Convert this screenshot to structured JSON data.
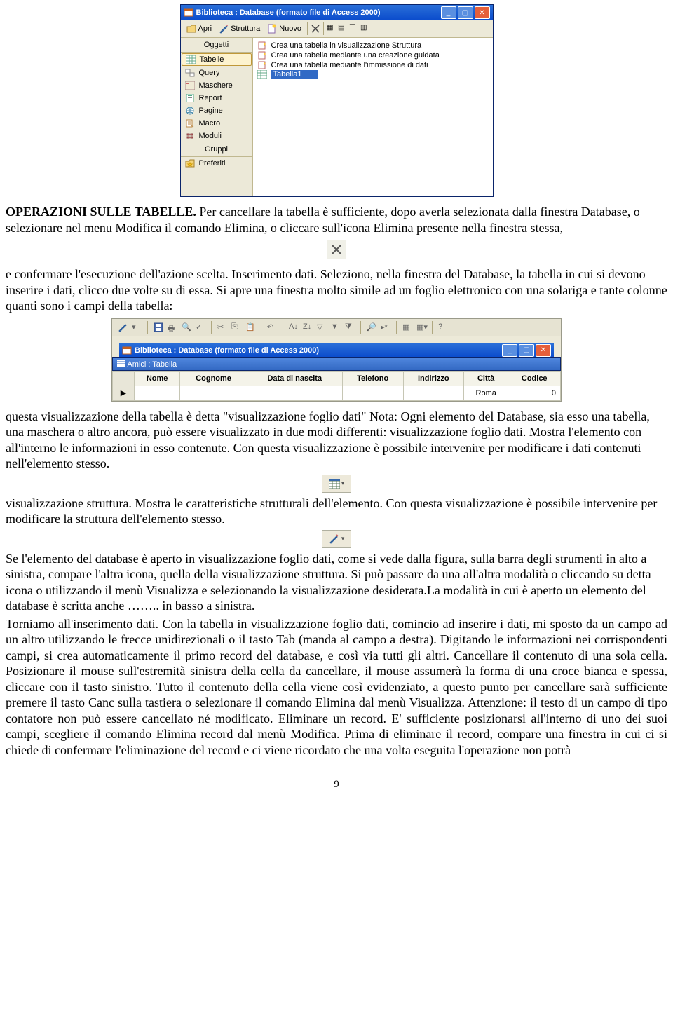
{
  "window1": {
    "title": "Biblioteca : Database (formato file di Access 2000)",
    "toolbar": {
      "apri": "Apri",
      "struttura": "Struttura",
      "nuovo": "Nuovo"
    },
    "sidebar": {
      "header_objects": "Oggetti",
      "items": [
        {
          "label": "Tabelle"
        },
        {
          "label": "Query"
        },
        {
          "label": "Maschere"
        },
        {
          "label": "Report"
        },
        {
          "label": "Pagine"
        },
        {
          "label": "Macro"
        },
        {
          "label": "Moduli"
        }
      ],
      "header_groups": "Gruppi",
      "group_item": "Preferiti"
    },
    "main": {
      "r1": "Crea una tabella in visualizzazione Struttura",
      "r2": "Crea una tabella mediante una creazione guidata",
      "r3": "Crea una tabella mediante l'immissione di dati",
      "r4": "Tabella1"
    }
  },
  "heading1": "OPERAZIONI SULLE TABELLE.",
  "para1": "Per cancellare la tabella è sufficiente, dopo averla selezionata dalla finestra Database, o selezionare nel menu Modifica il comando Elimina, o cliccare sull'icona Elimina presente nella finestra stessa,",
  "para2": "e confermare l'esecuzione dell'azione scelta. Inserimento dati. Seleziono, nella finestra del Database, la tabella in cui si devono inserire i dati, clicco due volte su di essa. Si apre una finestra molto simile ad un foglio elettronico con una solariga e tante colonne quanti sono i campi della tabella:",
  "window2": {
    "title": "Biblioteca : Database (formato file di Access 2000)",
    "table_title": "Amici : Tabella",
    "headers": [
      "Nome",
      "Cognome",
      "Data di nascita",
      "Telefono",
      "Indirizzo",
      "Città",
      "Codice"
    ],
    "row": {
      "citta": "Roma",
      "codice": "0"
    }
  },
  "para3": "questa visualizzazione della tabella è detta \"visualizzazione foglio dati\" Nota: Ogni elemento del Database, sia esso una tabella, una maschera o altro ancora, può essere visualizzato in due modi differenti:  visualizzazione foglio dati. Mostra l'elemento con all'interno le informazioni in esso contenute. Con questa visualizzazione è possibile intervenire per modificare i dati contenuti nell'elemento stesso.",
  "para4": "visualizzazione struttura. Mostra le caratteristiche strutturali dell'elemento. Con questa visualizzazione è possibile intervenire per modificare la struttura dell'elemento stesso.",
  "para5": "Se l'elemento del database è aperto in visualizzazione foglio dati, come si vede dalla figura, sulla barra degli strumenti in alto a sinistra, compare l'altra icona, quella della visualizzazione struttura. Si può passare da una all'altra modalità o cliccando su detta icona o utilizzando il menù Visualizza e selezionando la visualizzazione desiderata.La modalità in cui è aperto un elemento del database è scritta anche …….. in basso a sinistra.",
  "para6": "Torniamo all'inserimento dati. Con la tabella in visualizzazione foglio dati, comincio ad inserire i dati, mi sposto da un campo ad un altro utilizzando le frecce unidirezionali o il tasto Tab (manda al campo a destra). Digitando le informazioni nei corrispondenti campi, si crea automaticamente il primo record del database, e così via tutti gli altri. Cancellare il contenuto di una sola cella. Posizionare il mouse sull'estremità sinistra della cella da cancellare, il mouse assumerà la forma di una croce bianca e spessa, cliccare con il tasto sinistro. Tutto il contenuto della cella viene così evidenziato, a questo punto per cancellare sarà sufficiente premere il tasto Canc sulla tastiera o selezionare il comando Elimina dal menù Visualizza. Attenzione: il testo di un campo di tipo contatore non può essere cancellato né modificato. Eliminare un record. E' sufficiente posizionarsi all'interno di uno dei suoi campi, scegliere il comando Elimina record dal menù Modifica. Prima di eliminare il record, compare una finestra in cui ci si chiede di confermare l'eliminazione del record e ci viene ricordato che una volta eseguita l'operazione non potrà",
  "pagenum": "9"
}
